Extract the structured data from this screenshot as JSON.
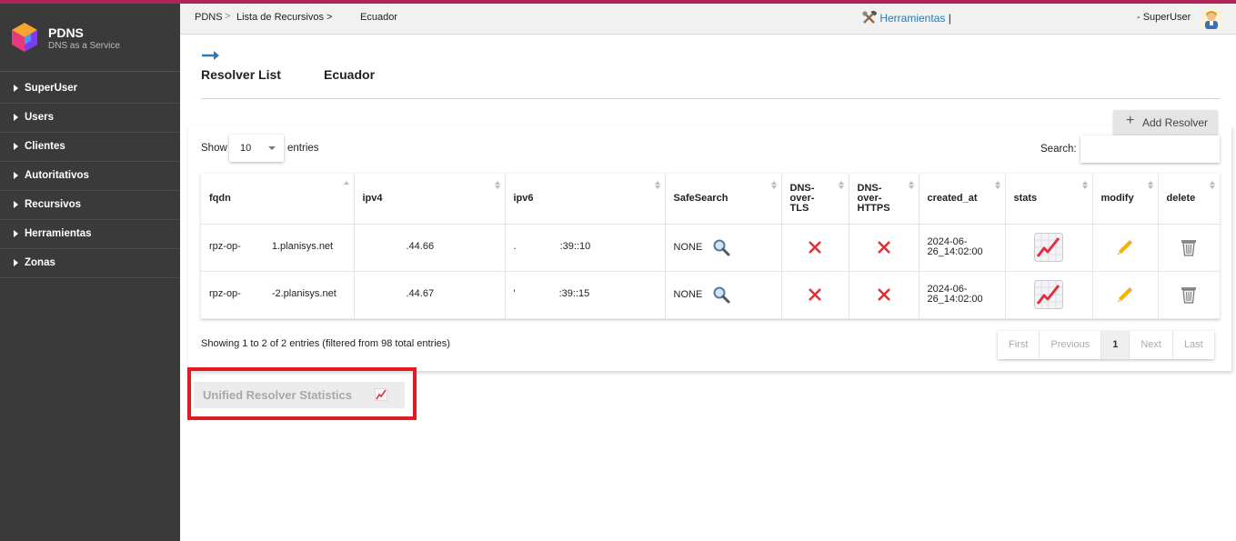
{
  "colors": {
    "top_stripe": "#b0245a",
    "sidebar_bg": "#3a3a3a",
    "link": "#2a7ab8",
    "highlight": "#e21b22",
    "delete_x": "#e03030",
    "stats_line": "#e03040"
  },
  "brand": {
    "name": "PDNS",
    "tagline": "DNS as a Service",
    "logo_icon": "hexagon-cube-icon"
  },
  "sidebar": {
    "items": [
      {
        "label": "SuperUser"
      },
      {
        "label": "Users"
      },
      {
        "label": "Clientes"
      },
      {
        "label": "Autoritativos"
      },
      {
        "label": "Recursivos"
      },
      {
        "label": "Herramientas"
      },
      {
        "label": "Zonas"
      }
    ]
  },
  "breadcrumb": {
    "items": [
      "PDNS",
      "Lista de Recursivos >",
      "Ecuador"
    ]
  },
  "topbar": {
    "tools_label": "Herramientas",
    "tools_suffix": "|",
    "user_label": "- SuperUser"
  },
  "page": {
    "title_left": "Resolver List",
    "title_right": "Ecuador",
    "add_button": "Add Resolver"
  },
  "table_controls": {
    "show_label": "Show",
    "page_size": "10",
    "entries_label": "entries",
    "search_label": "Search:",
    "search_value": ""
  },
  "table": {
    "headers": {
      "fqdn": "fqdn",
      "ipv4": "ipv4",
      "ipv6": "ipv6",
      "safesearch": "SafeSearch",
      "dot1": "DNS-",
      "dot2": "over-",
      "dot3": "TLS",
      "doh1": "DNS-",
      "doh2": "over-",
      "doh3": "HTTPS",
      "created": "created_at",
      "stats": "stats",
      "modify": "modify",
      "delete": "delete"
    },
    "rows": [
      {
        "fqdn_pre": "rpz-op-",
        "fqdn_post": "1.planisys.net",
        "ipv4": ".44.66",
        "ipv6_a": ".",
        "ipv6_b": ":39::10",
        "safesearch": "NONE",
        "created_1": "2024-06-",
        "created_2": "26_14:02:00"
      },
      {
        "fqdn_pre": "rpz-op-",
        "fqdn_post": "-2.planisys.net",
        "ipv4": ".44.67",
        "ipv6_a": "'",
        "ipv6_b": ":39::15",
        "safesearch": "NONE",
        "created_1": "2024-06-",
        "created_2": "26_14:02:00"
      }
    ]
  },
  "info": "Showing 1 to 2 of 2 entries (filtered from 98 total entries)",
  "pagination": {
    "first": "First",
    "previous": "Previous",
    "current": "1",
    "next": "Next",
    "last": "Last"
  },
  "unified_button": {
    "label": "Unified Resolver Statistics",
    "icon": "chart-increasing-icon"
  }
}
